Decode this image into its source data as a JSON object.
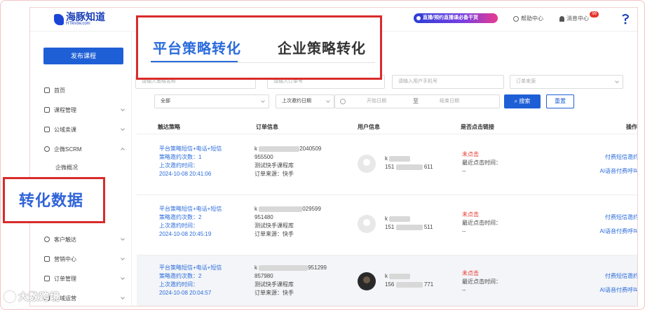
{
  "header": {
    "logo_text": "海豚知道",
    "logo_sub": "HTknow.com",
    "promo": "直播/预约直播课必备干货",
    "help_center": "帮助中心",
    "message_center": "消息中心",
    "message_badge": "99"
  },
  "sidebar": {
    "publish_label": "发布课程",
    "items": [
      {
        "label": "首页"
      },
      {
        "label": "课程管理"
      },
      {
        "label": "公域卖课"
      },
      {
        "label": "企微SCRM"
      },
      {
        "label": "客户触达"
      },
      {
        "label": "营销中心"
      },
      {
        "label": "订单管理"
      },
      {
        "label": "私域运营"
      }
    ],
    "sub_items": [
      "企微概况"
    ]
  },
  "annotations": {
    "side_callout": "转化数据",
    "tab_active": "平台策略转化",
    "tab_other": "企业策略转化"
  },
  "filters": {
    "strategy_placeholder": "请输入策略名称",
    "order_placeholder": "请输入订单号",
    "phone_placeholder": "请输入用户手机号",
    "source_placeholder": "订单来源",
    "status_value": "全部",
    "date_type_value": "上次邀约日期",
    "start_placeholder": "开始日期",
    "range_sep": "至",
    "end_placeholder": "结束日期",
    "search_label": "搜索",
    "reset_label": "重置"
  },
  "table": {
    "headers": [
      "触达策略",
      "订单信息",
      "用户信息",
      "是否点击链接",
      "操作"
    ],
    "rows": [
      {
        "strategy": "平台策略短信+电话+短信",
        "invites": "策略邀约次数：1",
        "last_invite": "上次邀约时间：",
        "time": "2024-10-08 20:41:06",
        "order_prefix": "k",
        "order_suffix": "2040509",
        "order_amount": "955500",
        "order_course": "测试快手课程库",
        "order_source": "订单来源：快手",
        "user_first": "k",
        "user_phone_prefix": "151",
        "user_phone_suffix": "611",
        "click_status": "未点击",
        "recent_click": "最近点击时间：",
        "recent_click_value": "--",
        "op1": "付费短信邀约",
        "op2": "AI语音付费呼叫"
      },
      {
        "strategy": "平台策略短信+电话+短信",
        "invites": "策略邀约次数：2",
        "last_invite": "上次邀约时间：",
        "time": "2024-10-08 20:45:19",
        "order_prefix": "k",
        "order_suffix": "029599",
        "order_amount": "951480",
        "order_course": "测试快手课程库",
        "order_source": "订单来源：快手",
        "user_first": "k",
        "user_phone_prefix": "151",
        "user_phone_suffix": "511",
        "click_status": "未点击",
        "recent_click": "最近点击时间：",
        "recent_click_value": "--",
        "op1": "付费短信邀约",
        "op2": "AI语音付费呼叫"
      },
      {
        "strategy": "平台策略短信+电话+短信",
        "invites": "策略邀约次数：2",
        "last_invite": "上次邀约时间：",
        "time": "2024-10-08 20:04:57",
        "order_prefix": "k",
        "order_suffix": "951299",
        "order_amount": "857980",
        "order_course": "测试快手课程库",
        "order_source": "订单来源：快手",
        "user_first": "k",
        "user_phone_prefix": "156",
        "user_phone_suffix": "771",
        "click_status": "未点击",
        "recent_click": "最近点击时间：",
        "recent_click_value": "--",
        "op1": "付费短信邀约",
        "op2": "AI语音付费呼叫"
      }
    ]
  },
  "watermark": "大数跨境",
  "colors": {
    "accent": "#1f5fd6",
    "callout_border": "#d92b2b",
    "link": "#2a6bdb",
    "status_red": "#e6342c"
  }
}
